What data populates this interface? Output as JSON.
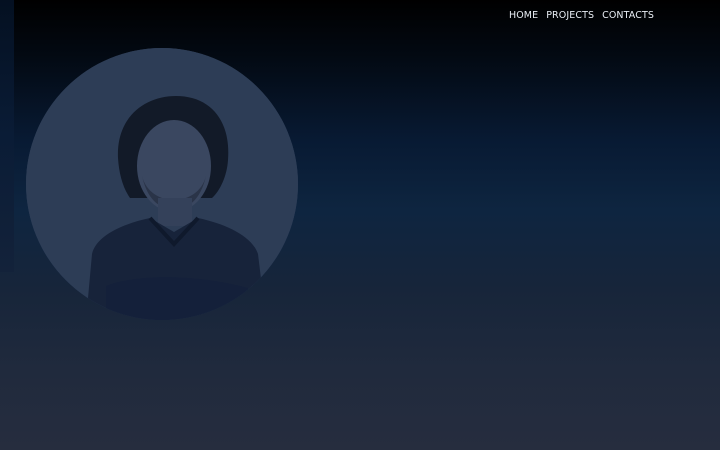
{
  "nav": {
    "items": [
      {
        "label": "HOME"
      },
      {
        "label": "PROJECTS"
      },
      {
        "label": "CONTACTS"
      }
    ]
  },
  "colors": {
    "nav_text": "#e9eef5",
    "background_top": "#000000",
    "background_mid": "#0e2540",
    "background_bottom": "#262d3e"
  },
  "portrait": {
    "icon": "profile-photo"
  }
}
